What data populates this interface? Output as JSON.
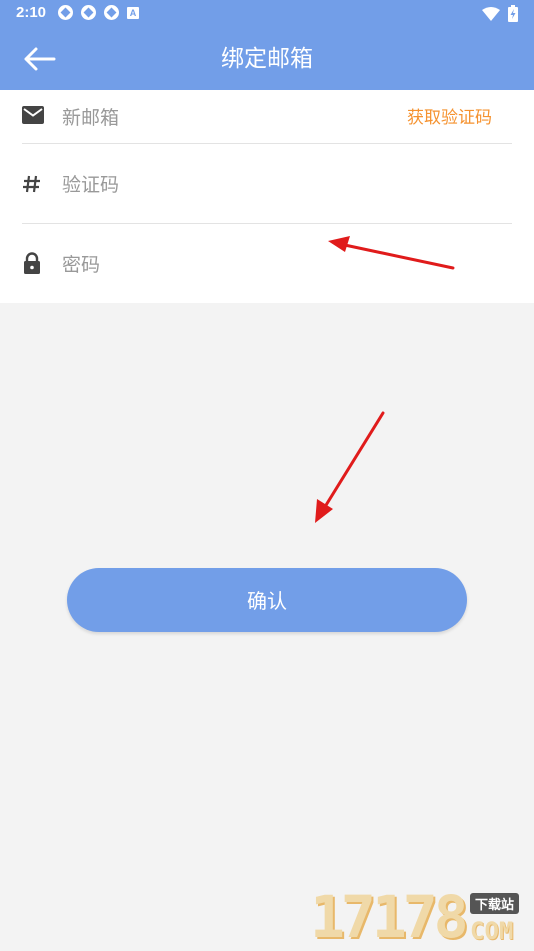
{
  "status_bar": {
    "time": "2:10",
    "notification_icon_letter": "A",
    "icons": [
      "sync-icon",
      "sync-icon",
      "sync-icon",
      "a-notification-icon",
      "wifi-icon",
      "battery-charging-icon"
    ]
  },
  "header": {
    "title": "绑定邮箱",
    "back_icon": "arrow-left-icon",
    "background_color": "#729ee8"
  },
  "form": {
    "email": {
      "placeholder": "新邮箱",
      "value": "",
      "icon": "envelope-icon",
      "send_code_label": "获取验证码"
    },
    "code": {
      "placeholder": "验证码",
      "value": "",
      "icon": "hash-icon"
    },
    "password": {
      "placeholder": "密码",
      "value": "",
      "icon": "lock-icon"
    }
  },
  "confirm_button": {
    "label": "确认",
    "color": "#729ee8"
  },
  "accent_color": "#f5922f",
  "annotations": {
    "arrow_color": "#e01b1b",
    "count": 2
  },
  "watermark": {
    "number": "17178",
    "tag": "下载站",
    "suffix": "COM"
  }
}
